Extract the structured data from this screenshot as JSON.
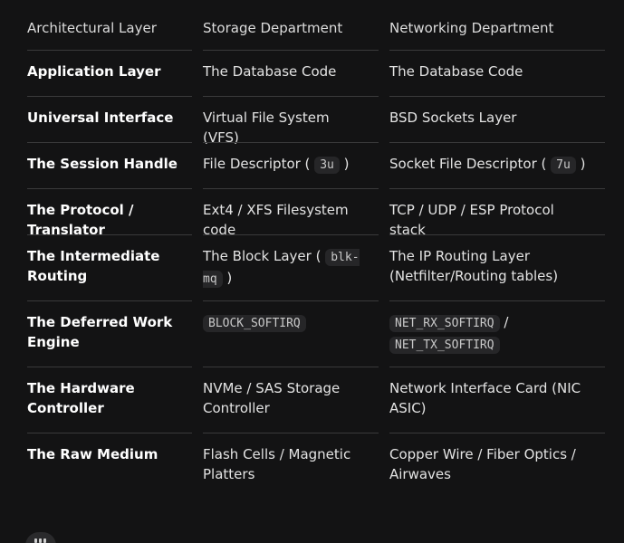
{
  "header": {
    "col0": "Architectural Layer",
    "col1": "Storage Department",
    "col2": "Networking Department"
  },
  "rows": [
    {
      "layer": "Application Layer",
      "storage": "The Database Code",
      "network": "The Database Code"
    },
    {
      "layer": "Universal Interface",
      "storage": "Virtual File System (VFS)",
      "network": "BSD Sockets Layer"
    },
    {
      "layer": "The Session Handle",
      "storage_pre": "File Descriptor ( ",
      "storage_code": "3u",
      "storage_post": " )",
      "network_pre": "Socket File Descriptor ( ",
      "network_code": "7u",
      "network_post": " )"
    },
    {
      "layer_line1": "The Protocol /",
      "layer_line2": "Translator",
      "storage": "Ext4 / XFS Filesystem code",
      "network": "TCP / UDP / ESP Protocol stack"
    },
    {
      "layer_line1": "The Intermediate",
      "layer_line2": "Routing",
      "storage_pre": "The Block Layer ( ",
      "storage_code": "blk-mq",
      "storage_post": " )",
      "network_line1": "The IP Routing Layer",
      "network_line2": "(Netfilter/Routing tables)"
    },
    {
      "layer_line1": "The Deferred Work",
      "layer_line2": "Engine",
      "storage_code": "BLOCK_SOFTIRQ",
      "network_code1": "NET_RX_SOFTIRQ",
      "network_sep": " /",
      "network_code2": "NET_TX_SOFTIRQ"
    },
    {
      "layer_line1": "The Hardware",
      "layer_line2": "Controller",
      "storage_line1": "NVMe / SAS Storage",
      "storage_line2": "Controller",
      "network_line1": "Network Interface Card (NIC",
      "network_line2": "ASIC)"
    },
    {
      "layer": "The Raw Medium",
      "storage_line1": "Flash Cells / Magnetic",
      "storage_line2": "Platters",
      "network_line1": "Copper Wire / Fiber Optics /",
      "network_line2": "Airwaves"
    }
  ],
  "footer": {
    "icon": "more-options-icon"
  }
}
